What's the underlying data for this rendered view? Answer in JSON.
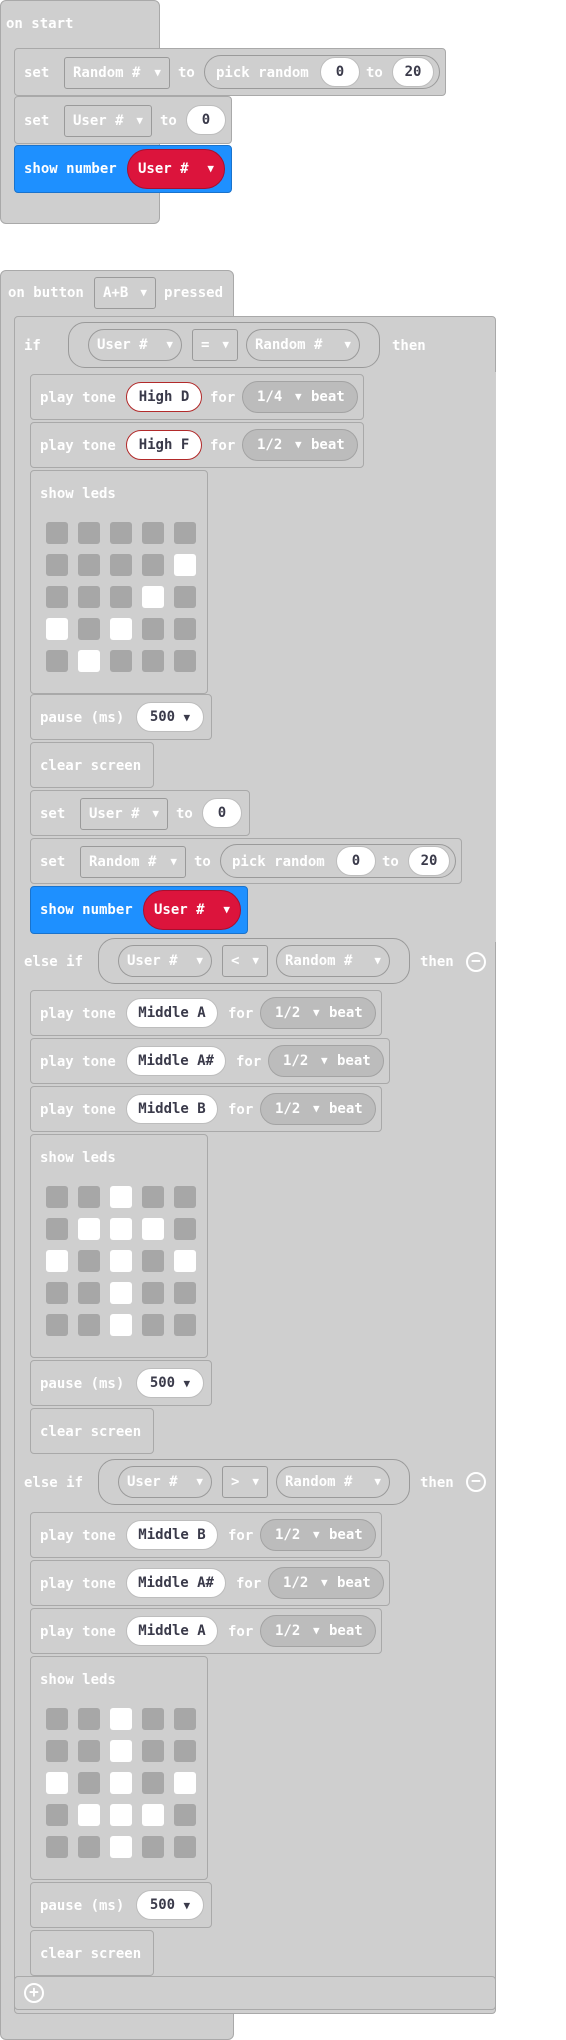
{
  "on_start": {
    "title": "on start",
    "set1": {
      "set": "set",
      "var": "Random #",
      "to": "to",
      "pick": "pick random",
      "min": "0",
      "to2": "to",
      "max": "20"
    },
    "set2": {
      "set": "set",
      "var": "User #",
      "to": "to",
      "value": "0"
    },
    "show": {
      "label": "show number",
      "var": "User #"
    }
  },
  "on_button": {
    "prefix": "on button",
    "button": "A+B",
    "suffix": "pressed",
    "if": {
      "kw": "if",
      "left": "User #",
      "op": "=",
      "right": "Random #",
      "then": "then"
    },
    "tone1": {
      "play": "play tone",
      "note": "High D",
      "for": "for",
      "beat": "1/4",
      "beat_word": "beat"
    },
    "tone2": {
      "play": "play tone",
      "note": "High F",
      "for": "for",
      "beat": "1/2",
      "beat_word": "beat"
    },
    "leds1_label": "show leds",
    "pause1": {
      "label": "pause (ms)",
      "value": "500"
    },
    "clear1": "clear screen",
    "set3": {
      "set": "set",
      "var": "User #",
      "to": "to",
      "value": "0"
    },
    "set4": {
      "set": "set",
      "var": "Random #",
      "to": "to",
      "pick": "pick random",
      "min": "0",
      "to2": "to",
      "max": "20"
    },
    "show2": {
      "label": "show number",
      "var": "User #"
    },
    "elseif1": {
      "kw": "else if",
      "left": "User #",
      "op": "<",
      "right": "Random #",
      "then": "then"
    },
    "tone3": {
      "play": "play tone",
      "note": "Middle A",
      "for": "for",
      "beat": "1/2",
      "beat_word": "beat"
    },
    "tone4": {
      "play": "play tone",
      "note": "Middle A#",
      "for": "for",
      "beat": "1/2",
      "beat_word": "beat"
    },
    "tone5": {
      "play": "play tone",
      "note": "Middle B",
      "for": "for",
      "beat": "1/2",
      "beat_word": "beat"
    },
    "leds2_label": "show leds",
    "pause2": {
      "label": "pause (ms)",
      "value": "500"
    },
    "clear2": "clear screen",
    "elseif2": {
      "kw": "else if",
      "left": "User #",
      "op": ">",
      "right": "Random #",
      "then": "then"
    },
    "tone6": {
      "play": "play tone",
      "note": "Middle B",
      "for": "for",
      "beat": "1/2",
      "beat_word": "beat"
    },
    "tone7": {
      "play": "play tone",
      "note": "Middle A#",
      "for": "for",
      "beat": "1/2",
      "beat_word": "beat"
    },
    "tone8": {
      "play": "play tone",
      "note": "Middle A",
      "for": "for",
      "beat": "1/2",
      "beat_word": "beat"
    },
    "leds3_label": "show leds",
    "pause3": {
      "label": "pause (ms)",
      "value": "500"
    },
    "clear3": "clear screen"
  },
  "leds": {
    "grid1": [
      [
        0,
        0,
        0,
        0,
        0
      ],
      [
        0,
        0,
        0,
        0,
        1
      ],
      [
        0,
        0,
        0,
        1,
        0
      ],
      [
        1,
        0,
        1,
        0,
        0
      ],
      [
        0,
        1,
        0,
        0,
        0
      ]
    ],
    "grid2": [
      [
        0,
        0,
        1,
        0,
        0
      ],
      [
        0,
        1,
        1,
        1,
        0
      ],
      [
        1,
        0,
        1,
        0,
        1
      ],
      [
        0,
        0,
        1,
        0,
        0
      ],
      [
        0,
        0,
        1,
        0,
        0
      ]
    ],
    "grid3": [
      [
        0,
        0,
        1,
        0,
        0
      ],
      [
        0,
        0,
        1,
        0,
        0
      ],
      [
        1,
        0,
        1,
        0,
        1
      ],
      [
        0,
        1,
        1,
        1,
        0
      ],
      [
        0,
        0,
        1,
        0,
        0
      ]
    ]
  },
  "icons": {
    "remove": "minus-circle-icon",
    "add": "plus-circle-icon",
    "dropdown": "caret-down-icon"
  },
  "colors": {
    "block": "#cfcfcf",
    "basic": "#1e90ff",
    "variable": "#dc143c",
    "led_on": "#ffffff",
    "led_off": "#a7a7a7"
  },
  "glyphs": {
    "caret": "▼",
    "minus": "−",
    "plus": "+"
  }
}
